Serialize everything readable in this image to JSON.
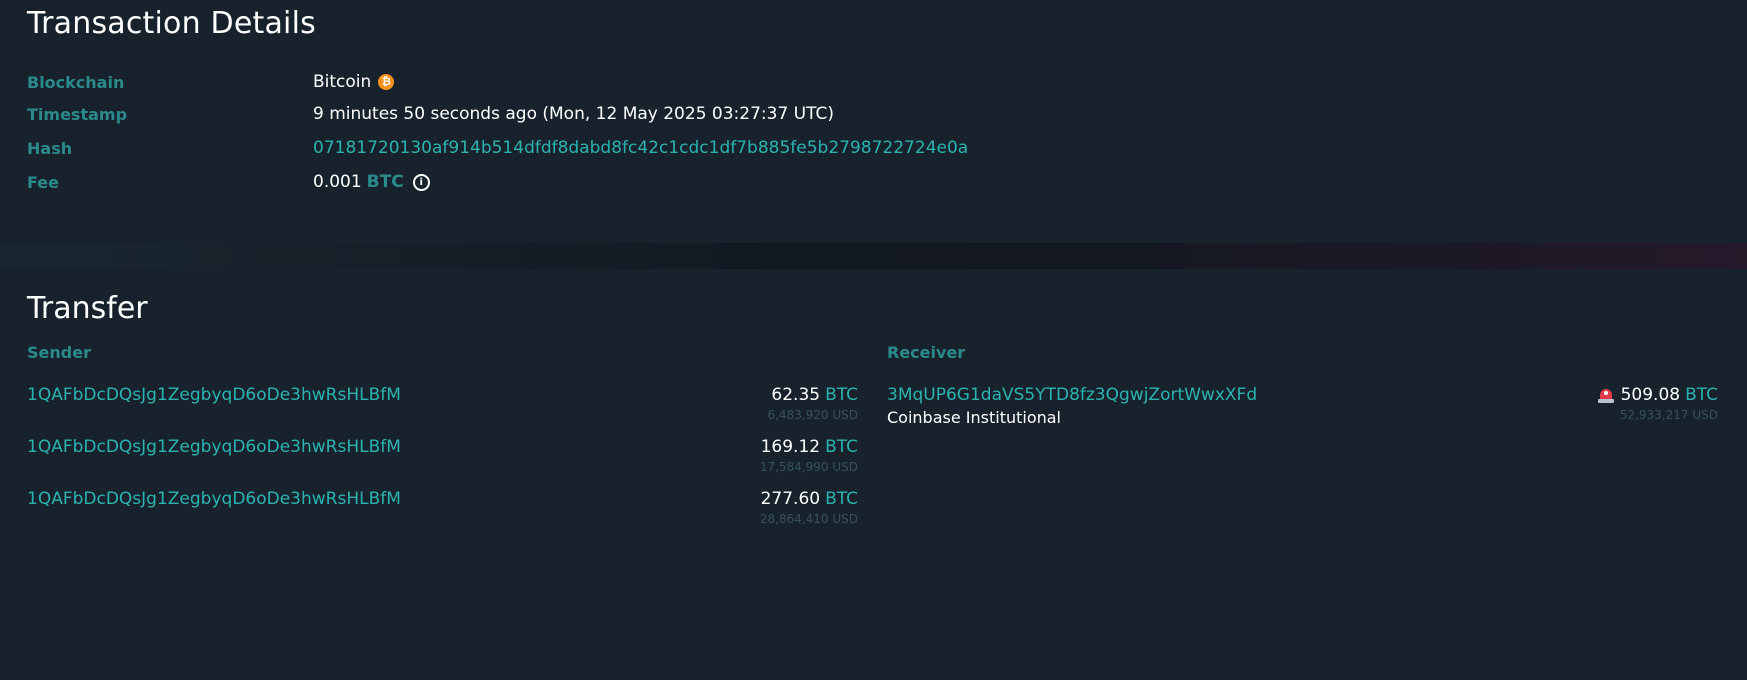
{
  "details": {
    "title": "Transaction Details",
    "rows": [
      {
        "label": "Blockchain",
        "value": "Bitcoin",
        "icon": "bitcoin-coin-icon",
        "icon_glyph": "₿"
      },
      {
        "label": "Timestamp",
        "value": "9 minutes 50 seconds ago (Mon, 12 May 2025 03:27:37 UTC)"
      },
      {
        "label": "Hash",
        "value": "07181720130af914b514dfdf8dabd8fc42c1cdc1df7b885fe5b2798722724e0a"
      },
      {
        "label": "Fee",
        "value": "0.001",
        "unit": "BTC",
        "icon": "info-icon",
        "icon_glyph": "i"
      }
    ]
  },
  "transfer": {
    "title": "Transfer",
    "sender_label": "Sender",
    "receiver_label": "Receiver",
    "senders": [
      {
        "address": "1QAFbDcDQsJg1ZegbyqD6oDe3hwRsHLBfM",
        "amount": "62.35",
        "unit": "BTC",
        "usd": "6,483,920 USD"
      },
      {
        "address": "1QAFbDcDQsJg1ZegbyqD6oDe3hwRsHLBfM",
        "amount": "169.12",
        "unit": "BTC",
        "usd": "17,584,990 USD"
      },
      {
        "address": "1QAFbDcDQsJg1ZegbyqD6oDe3hwRsHLBfM",
        "amount": "277.60",
        "unit": "BTC",
        "usd": "28,864,410 USD"
      }
    ],
    "receivers": [
      {
        "address": "3MqUP6G1daVS5YTD8fz3QgwjZortWwxXFd",
        "tag": "Coinbase Institutional",
        "amount": "509.08",
        "unit": "BTC",
        "usd": "52,933,217 USD",
        "icon": "alarm-siren-icon"
      }
    ]
  },
  "colors": {
    "background": "#17222c",
    "label": "#2a8a8c",
    "link": "#2bb3b1",
    "muted": "#35525c",
    "bitcoin": "#f7931a",
    "alert": "#e23b4a"
  }
}
